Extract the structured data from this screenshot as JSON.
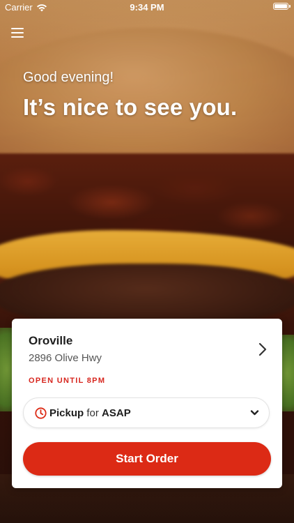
{
  "status_bar": {
    "carrier": "Carrier",
    "time": "9:34 PM",
    "icons": [
      "wifi-icon",
      "battery-icon"
    ]
  },
  "header": {
    "menu_icon": "hamburger-menu-icon"
  },
  "greeting": {
    "subtitle": "Good evening!",
    "title": "It’s nice to see you."
  },
  "location": {
    "name": "Oroville",
    "address": "2896 Olive Hwy",
    "status": "OPEN UNTIL 8PM",
    "icon": "chevron-right-icon"
  },
  "order_mode": {
    "icon": "clock-icon",
    "mode": "Pickup",
    "connector": "for",
    "time": "ASAP",
    "dropdown_icon": "chevron-down-icon"
  },
  "actions": {
    "start_order_label": "Start Order"
  },
  "colors": {
    "accent": "#dc2a15",
    "status_red": "#d7261e",
    "card_bg": "#ffffff",
    "text_dark": "#1e1e1e"
  }
}
